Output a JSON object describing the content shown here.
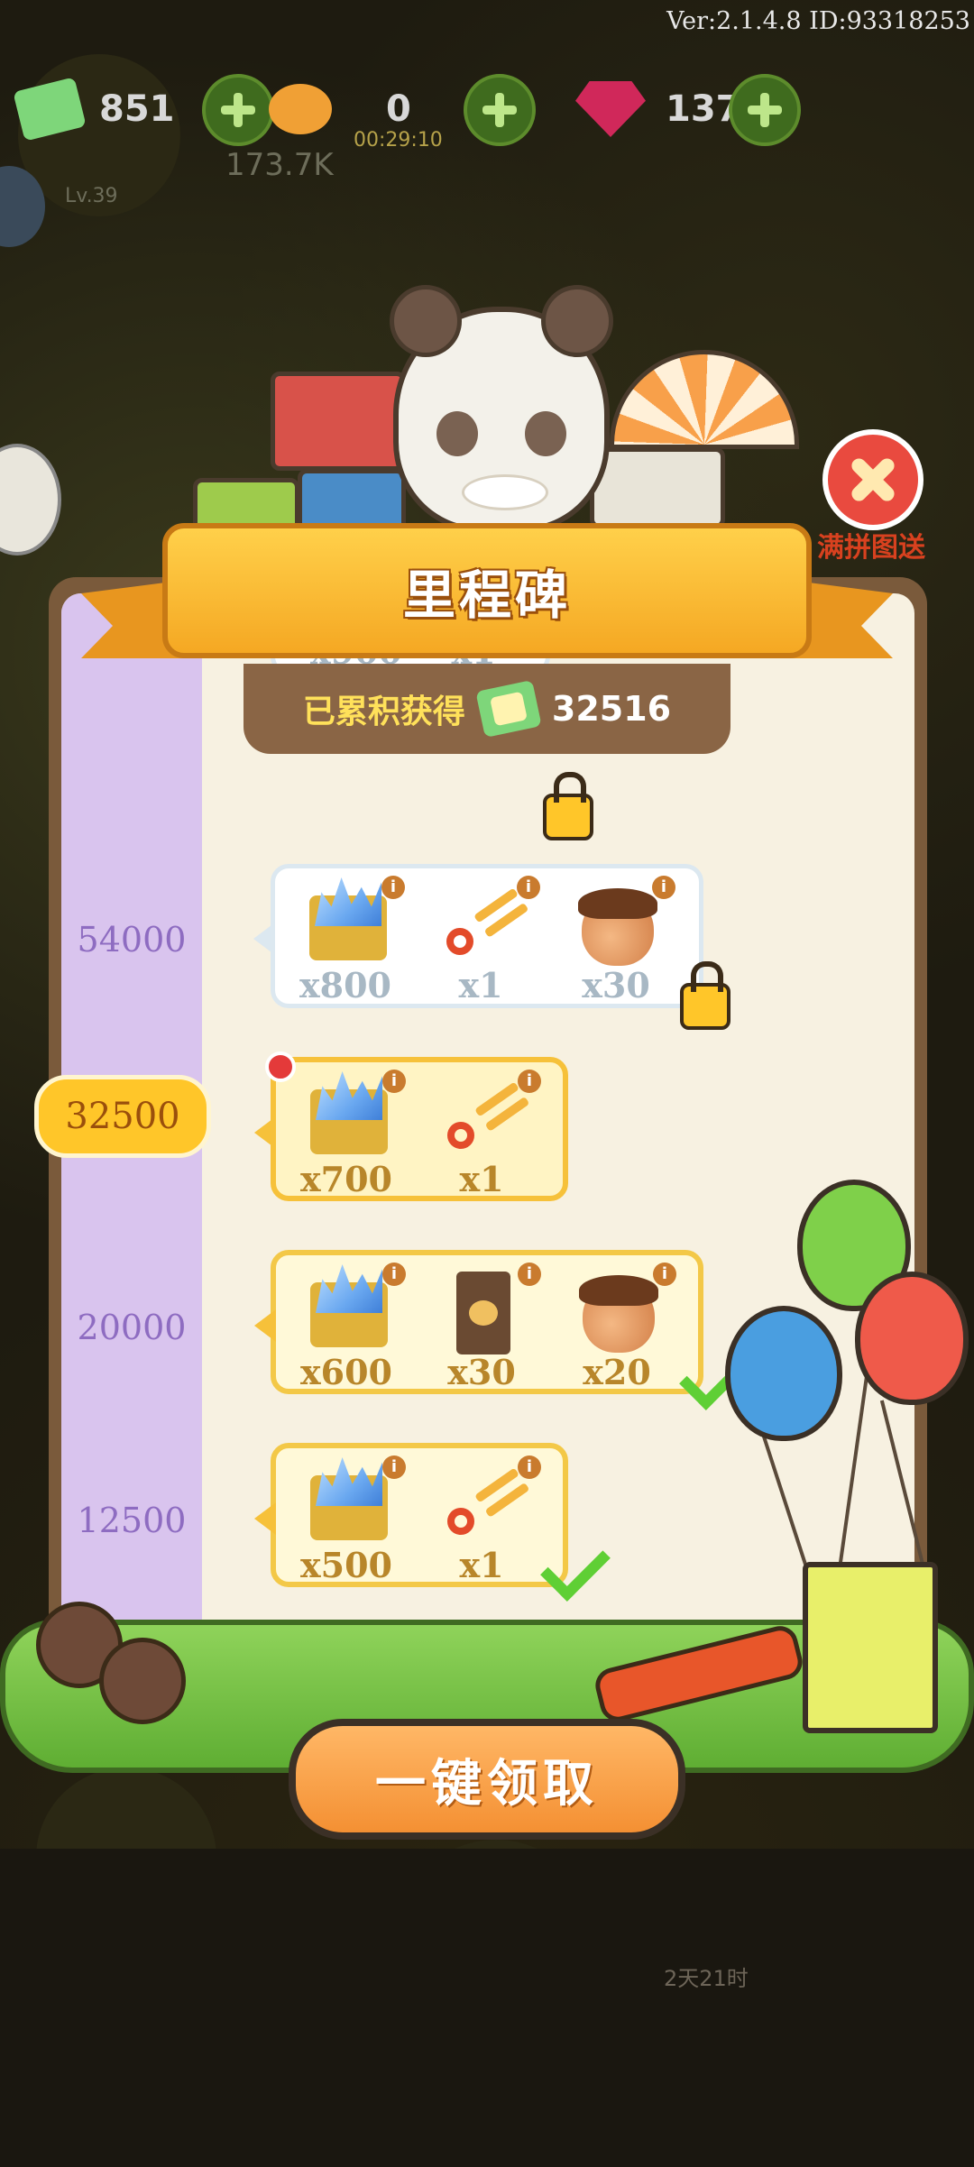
{
  "version": "Ver:2.1.4.8 ID:93318253",
  "resources": {
    "tickets": "851",
    "candy": "0",
    "candy_timer": "00:29:10",
    "gems": "1378",
    "power": "173.7K",
    "level": "Lv.39"
  },
  "dialog": {
    "title": "里程碑",
    "total_label": "已累积获得",
    "total_value": "32516",
    "close_caption": "满拼图送",
    "current_milestone": "32500",
    "claim_all_label": "一键领取"
  },
  "milestones": [
    {
      "threshold": "54000",
      "state": "locked",
      "items": [
        {
          "icon": "ice-crystal-box-icon",
          "qty": "x800"
        },
        {
          "icon": "scissors-icon",
          "qty": "x1"
        },
        {
          "icon": "acorn-icon",
          "qty": "x30"
        }
      ]
    },
    {
      "threshold": "32500",
      "state": "claimable",
      "items": [
        {
          "icon": "ice-crystal-box-icon",
          "qty": "x700"
        },
        {
          "icon": "scissors-icon",
          "qty": "x1"
        }
      ]
    },
    {
      "threshold": "20000",
      "state": "claimed",
      "items": [
        {
          "icon": "ice-crystal-box-icon",
          "qty": "x600"
        },
        {
          "icon": "food-bag-icon",
          "qty": "x30"
        },
        {
          "icon": "acorn-icon",
          "qty": "x20"
        }
      ]
    },
    {
      "threshold": "12500",
      "state": "claimed",
      "items": [
        {
          "icon": "ice-crystal-box-icon",
          "qty": "x500"
        },
        {
          "icon": "scissors-icon",
          "qty": "x1"
        }
      ]
    }
  ],
  "partial_top_card": {
    "items": [
      {
        "qty": "x900"
      },
      {
        "qty": "x1"
      }
    ]
  },
  "bottom_timer": "2天21时",
  "colors": {
    "accent": "#ffc629",
    "claimed_check": "#5fcf35",
    "sidebar": "#d9c4ee",
    "close": "#e94a3f"
  }
}
